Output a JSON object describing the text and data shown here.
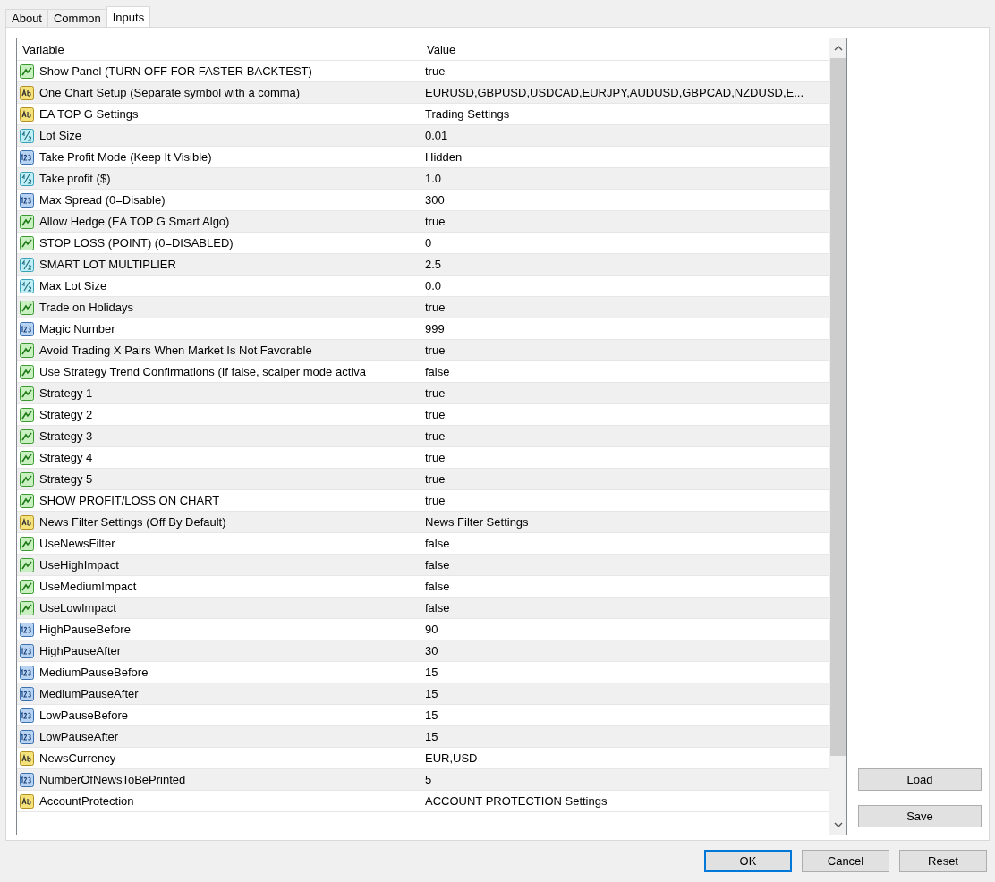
{
  "tabs": [
    {
      "label": "About",
      "selected": false
    },
    {
      "label": "Common",
      "selected": false
    },
    {
      "label": "Inputs",
      "selected": true
    }
  ],
  "table": {
    "columns": [
      "Variable",
      "Value"
    ],
    "rows": [
      {
        "kind": "bool",
        "variable": "Show Panel (TURN OFF FOR FASTER BACKTEST)",
        "value": "true"
      },
      {
        "kind": "string",
        "variable": "One Chart Setup (Separate symbol with a comma)",
        "value": "EURUSD,GBPUSD,USDCAD,EURJPY,AUDUSD,GBPCAD,NZDUSD,E..."
      },
      {
        "kind": "string",
        "variable": "EA TOP G Settings",
        "value": "Trading Settings"
      },
      {
        "kind": "double",
        "variable": "Lot Size",
        "value": "0.01"
      },
      {
        "kind": "int",
        "variable": "Take Profit Mode (Keep It Visible)",
        "value": "Hidden"
      },
      {
        "kind": "double",
        "variable": "Take profit ($)",
        "value": "1.0"
      },
      {
        "kind": "int",
        "variable": "Max Spread (0=Disable)",
        "value": "300"
      },
      {
        "kind": "bool",
        "variable": "Allow Hedge (EA TOP G Smart Algo)",
        "value": "true"
      },
      {
        "kind": "bool",
        "variable": "STOP LOSS (POINT) (0=DISABLED)",
        "value": "0"
      },
      {
        "kind": "double",
        "variable": "SMART LOT MULTIPLIER",
        "value": "2.5"
      },
      {
        "kind": "double",
        "variable": "Max Lot Size",
        "value": "0.0"
      },
      {
        "kind": "bool",
        "variable": "Trade on Holidays",
        "value": "true"
      },
      {
        "kind": "int",
        "variable": "Magic Number",
        "value": "999"
      },
      {
        "kind": "bool",
        "variable": "Avoid Trading X Pairs When Market Is Not Favorable",
        "value": "true"
      },
      {
        "kind": "bool",
        "variable": "Use Strategy Trend Confirmations (If false, scalper mode activa",
        "value": "false"
      },
      {
        "kind": "bool",
        "variable": "Strategy 1",
        "value": "true"
      },
      {
        "kind": "bool",
        "variable": "Strategy 2",
        "value": "true"
      },
      {
        "kind": "bool",
        "variable": "Strategy 3",
        "value": "true"
      },
      {
        "kind": "bool",
        "variable": "Strategy 4",
        "value": "true"
      },
      {
        "kind": "bool",
        "variable": "Strategy 5",
        "value": "true"
      },
      {
        "kind": "bool",
        "variable": "SHOW PROFIT/LOSS ON CHART",
        "value": "true"
      },
      {
        "kind": "string",
        "variable": "News Filter Settings (Off By Default)",
        "value": "News Filter Settings"
      },
      {
        "kind": "bool",
        "variable": "UseNewsFilter",
        "value": "false"
      },
      {
        "kind": "bool",
        "variable": "UseHighImpact",
        "value": "false"
      },
      {
        "kind": "bool",
        "variable": "UseMediumImpact",
        "value": "false"
      },
      {
        "kind": "bool",
        "variable": "UseLowImpact",
        "value": "false"
      },
      {
        "kind": "int",
        "variable": "HighPauseBefore",
        "value": "90"
      },
      {
        "kind": "int",
        "variable": "HighPauseAfter",
        "value": "30"
      },
      {
        "kind": "int",
        "variable": "MediumPauseBefore",
        "value": "15"
      },
      {
        "kind": "int",
        "variable": "MediumPauseAfter",
        "value": "15"
      },
      {
        "kind": "int",
        "variable": "LowPauseBefore",
        "value": "15"
      },
      {
        "kind": "int",
        "variable": "LowPauseAfter",
        "value": "15"
      },
      {
        "kind": "string",
        "variable": "NewsCurrency",
        "value": "EUR,USD"
      },
      {
        "kind": "int",
        "variable": "NumberOfNewsToBePrinted",
        "value": "5"
      },
      {
        "kind": "string",
        "variable": "AccountProtection",
        "value": "ACCOUNT PROTECTION Settings"
      }
    ]
  },
  "side_buttons": [
    "Load",
    "Save"
  ],
  "buttons": [
    {
      "label": "OK",
      "default": true
    },
    {
      "label": "Cancel",
      "default": false
    },
    {
      "label": "Reset",
      "default": false
    }
  ]
}
